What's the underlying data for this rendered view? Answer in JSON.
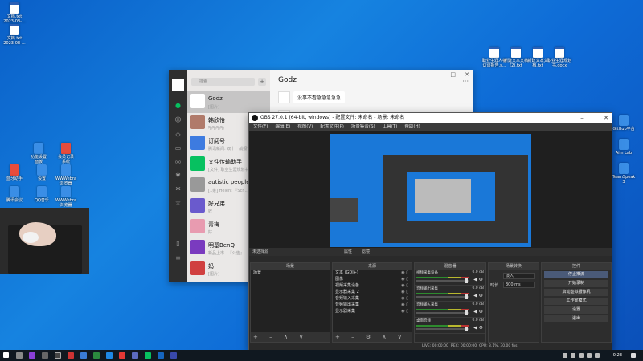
{
  "desktop": {
    "left_icons": [
      {
        "label": "文档.txt\n2023-03-...",
        "kind": "doc"
      },
      {
        "label": "文档.txt\n2023-03-...",
        "kind": "doc"
      },
      {
        "label": "功能设置\n面板",
        "kind": "app"
      },
      {
        "label": "会员记录\n系统",
        "kind": "red"
      },
      {
        "label": "蓝牙助手",
        "kind": "red"
      },
      {
        "label": "设置",
        "kind": "app"
      },
      {
        "label": "WWWebra\n浏览器",
        "kind": "app"
      },
      {
        "label": "腾讯会议",
        "kind": "app"
      },
      {
        "label": "QQ音乐",
        "kind": "app"
      },
      {
        "label": "WWWebra\n浏览器",
        "kind": "app"
      }
    ],
    "top_right_icons": [
      {
        "label": "职业生涯人物\n访谈报告.s...",
        "kind": "doc"
      },
      {
        "label": "新建文本文档\n(2).txt",
        "kind": "doc"
      },
      {
        "label": "新建文本文\n档.txt",
        "kind": "doc"
      },
      {
        "label": "职业生涯规划\n书.docx",
        "kind": "doc"
      }
    ],
    "right_icons": [
      {
        "label": "GitHub平台",
        "kind": "app"
      },
      {
        "label": "Aim Lab",
        "kind": "app"
      },
      {
        "label": "TeamSpeak\n3",
        "kind": "app"
      }
    ]
  },
  "wechat": {
    "search_placeholder": "搜索",
    "chat_title": "Godz",
    "contacts": [
      {
        "name": "Godz",
        "sub": "[图片]",
        "selected": true
      },
      {
        "name": "韩欣怡",
        "sub": "哈哈哈哈"
      },
      {
        "name": "订阅号",
        "sub": "腾讯新闻: 双十一战报首..."
      },
      {
        "name": "文件传输助手",
        "sub": "[文件] 职业生涯规划书"
      },
      {
        "name": "autistic people room",
        "sub": "[1条] Helen: 『Scr...』"
      },
      {
        "name": "好兄弟",
        "sub": "收"
      },
      {
        "name": "青梅",
        "sub": "好"
      },
      {
        "name": "明基BenQ",
        "sub": "新品上市...『公告』"
      },
      {
        "name": "妈",
        "sub": "[图片]"
      }
    ],
    "messages": [
      {
        "text": "没事不看急急急急急"
      },
      {
        "text": ""
      }
    ]
  },
  "obs": {
    "title": "OBS 27.0.1 (64-bit, windows) - 配置文件: 未命名 - 场景: 未命名",
    "menu": [
      "文件(F)",
      "编辑(E)",
      "视图(V)",
      "配置文件(P)",
      "场景集合(S)",
      "工具(T)",
      "帮助(H)"
    ],
    "source_bar": {
      "label": "未选择源",
      "properties": "属性",
      "filters": "滤镜"
    },
    "docks": {
      "scenes": {
        "title": "场景",
        "items": [
          "场景"
        ]
      },
      "sources": {
        "title": "来源",
        "items": [
          "文本 (GDI+)",
          "图像",
          "视频采集设备",
          "显示器采集 2",
          "音频输入采集",
          "音频输出采集",
          "显示器采集"
        ]
      },
      "mixer": {
        "title": "混音器",
        "channels": [
          {
            "name": "视频采集设备",
            "db": "0.0 dB"
          },
          {
            "name": "音频输出采集",
            "db": "0.0 dB"
          },
          {
            "name": "音频输入采集",
            "db": "0.0 dB"
          },
          {
            "name": "桌面音频",
            "db": "0.0 dB"
          }
        ]
      },
      "transitions": {
        "title": "场景转换",
        "type": "淡入",
        "duration_label": "时长",
        "duration": "300 ms"
      },
      "controls": {
        "title": "控件",
        "buttons": [
          "停止推流",
          "开始录制",
          "启动虚拟摄像机",
          "工作室模式",
          "设置",
          "退出"
        ]
      }
    },
    "status": {
      "live": "LIVE: 00:00:00",
      "rec": "REC: 00:00:00",
      "cpu": "CPU: 3.1%, 30.00 fps",
      "kbps": "延迟 (帧) 0 kb/s 丢帧 0"
    }
  },
  "taskbar": {
    "time": "0:23"
  }
}
